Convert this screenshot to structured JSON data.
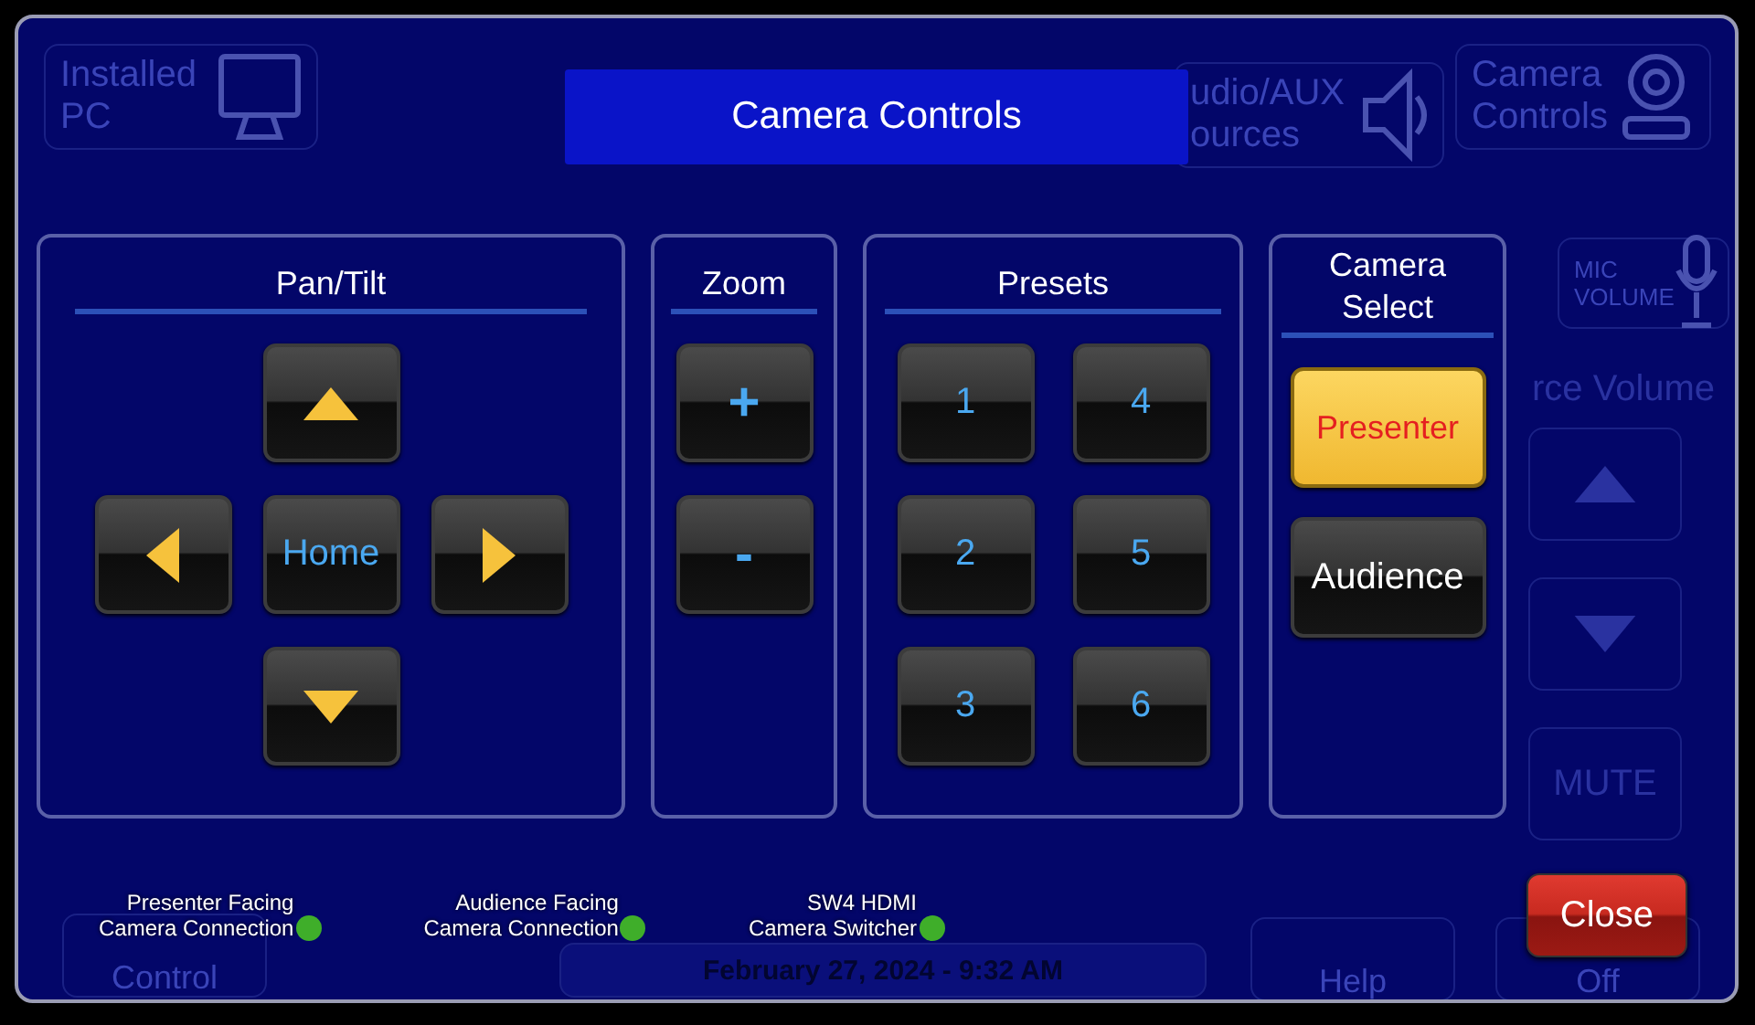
{
  "background": {
    "tiles": [
      {
        "lines": [
          "Installed",
          "PC"
        ],
        "kind": "monitor"
      },
      {
        "lines": [
          "udio/AUX",
          "ources"
        ],
        "kind": "speaker"
      },
      {
        "lines": [
          "Camera",
          "Controls"
        ],
        "kind": "camera"
      },
      {
        "lines": [
          "MIC",
          "VOLUME"
        ],
        "kind": "mic"
      }
    ],
    "volume_label": "rce Volume",
    "volume_buttons": [
      {
        "kind": "up"
      },
      {
        "kind": "down"
      },
      {
        "kind": "text",
        "label": "MUTE"
      }
    ],
    "bottom": [
      {
        "kind": "control",
        "label": "Control"
      },
      {
        "kind": "date",
        "label": "February 27, 2024  -  9:32 AM"
      },
      {
        "kind": "help",
        "label": "Help"
      },
      {
        "kind": "off",
        "label": "Off"
      }
    ]
  },
  "dialog": {
    "title": "Camera Controls",
    "pan_tilt": {
      "title": "Pan/Tilt",
      "buttons": [
        {
          "kind": "up"
        },
        {
          "kind": "left"
        },
        {
          "kind": "home",
          "label": "Home"
        },
        {
          "kind": "right"
        },
        {
          "kind": "down"
        }
      ]
    },
    "zoom": {
      "title": "Zoom",
      "buttons": [
        "+",
        "-"
      ]
    },
    "presets": {
      "title": "Presets",
      "buttons": [
        "1",
        "2",
        "3",
        "4",
        "5",
        "6"
      ]
    },
    "camera_select": {
      "title": "Camera Select",
      "options": [
        {
          "label": "Presenter",
          "selected": true
        },
        {
          "label": "Audience",
          "selected": false
        }
      ]
    },
    "status": [
      {
        "lines": [
          "Presenter Facing",
          "Camera Connection"
        ],
        "color": "#3fae2a"
      },
      {
        "lines": [
          "Audience Facing",
          "Camera Connection"
        ],
        "color": "#3fae2a"
      },
      {
        "lines": [
          "SW4 HDMI",
          "Camera Switcher"
        ],
        "color": "#3fae2a"
      }
    ],
    "close": "Close"
  }
}
